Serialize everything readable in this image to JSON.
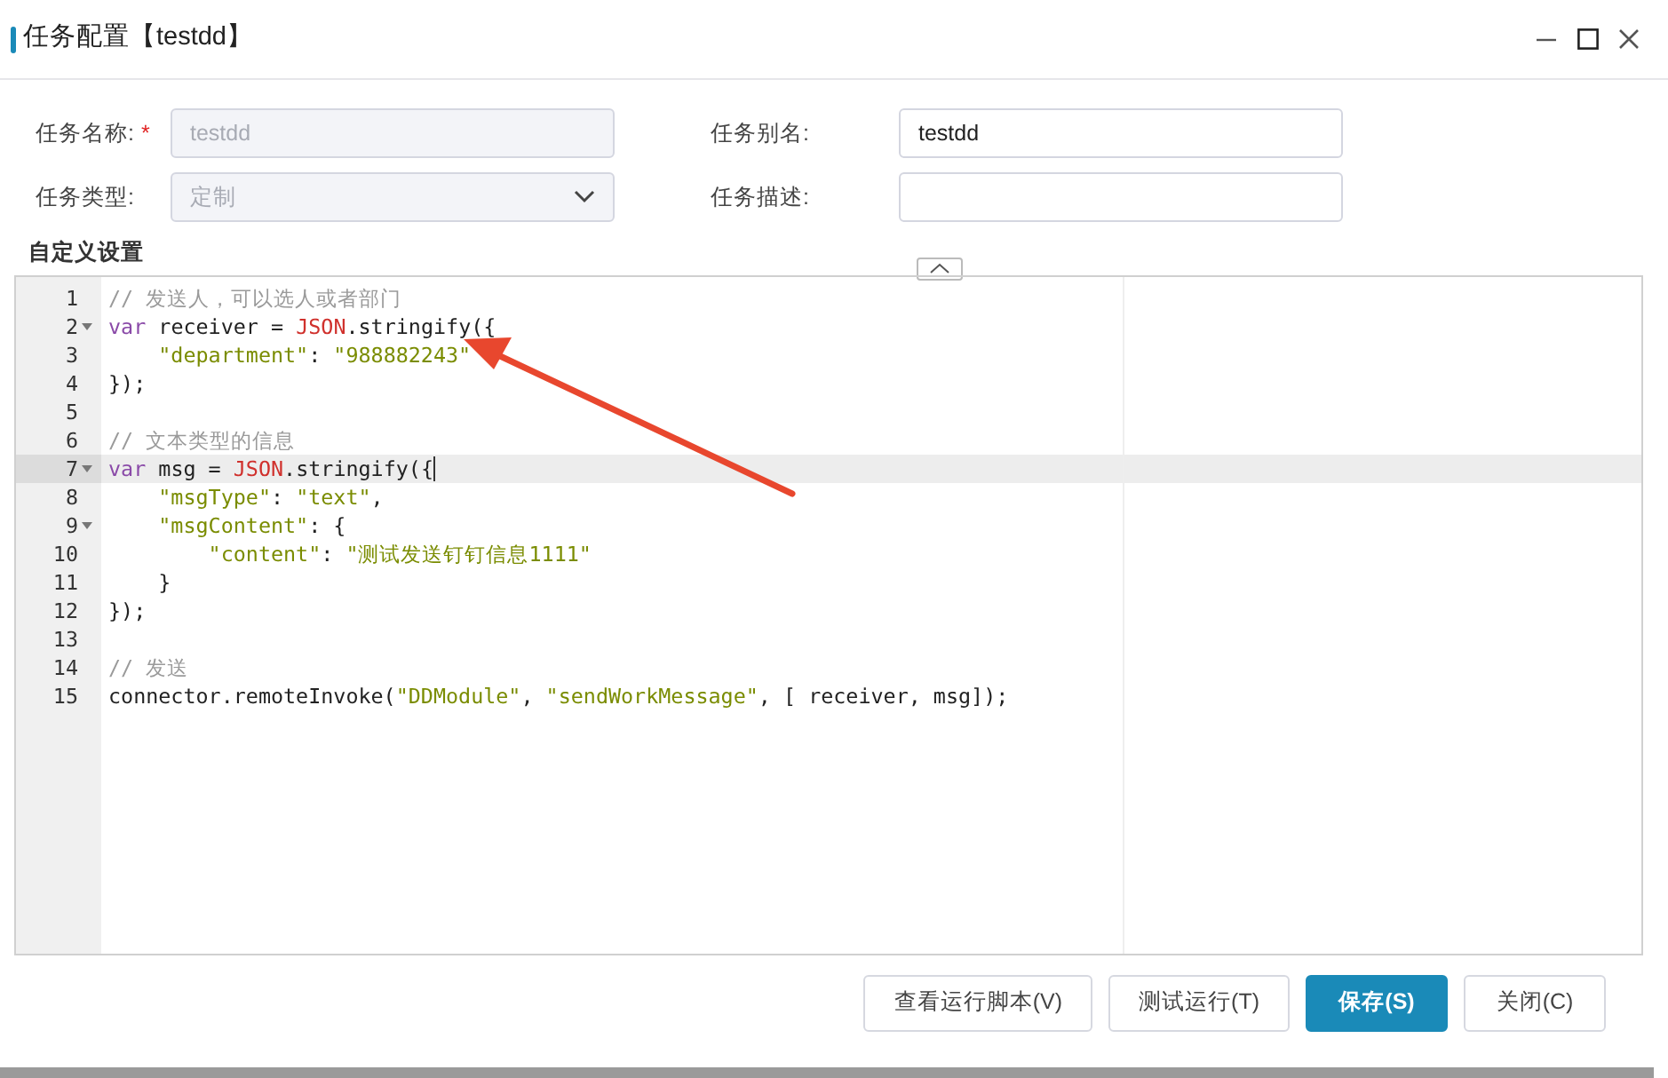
{
  "window": {
    "title": "任务配置【testdd】"
  },
  "form": [
    {
      "label": "任务名称:",
      "required_mark": "*",
      "kind": "input",
      "value": "testdd",
      "disabled": true
    },
    {
      "label": "任务别名:",
      "kind": "input",
      "value": "testdd",
      "disabled": false
    },
    {
      "label": "任务类型:",
      "kind": "select",
      "value": "定制",
      "disabled": true
    },
    {
      "label": "任务描述:",
      "kind": "input",
      "disabled": false
    }
  ],
  "section_title": "自定义设置",
  "editor": {
    "lines": [
      {
        "number": "1",
        "fold": false,
        "active": false,
        "tokens": [
          {
            "kind": "comment",
            "text": "// 发送人，可以选人或者部门"
          }
        ]
      },
      {
        "number": "2",
        "fold": true,
        "active": false,
        "tokens": [
          {
            "kind": "keyword",
            "text": "var"
          },
          {
            "kind": "plain",
            "text": " receiver = "
          },
          {
            "kind": "builtin",
            "text": "JSON"
          },
          {
            "kind": "plain",
            "text": ".stringify({"
          }
        ]
      },
      {
        "number": "3",
        "fold": false,
        "active": false,
        "tokens": [
          {
            "kind": "string",
            "text": "    \"department\""
          },
          {
            "kind": "plain",
            "text": ": "
          },
          {
            "kind": "string",
            "text": "\"988882243\""
          }
        ]
      },
      {
        "number": "4",
        "fold": false,
        "active": false,
        "tokens": [
          {
            "kind": "plain",
            "text": "});"
          }
        ]
      },
      {
        "number": "5",
        "fold": false,
        "active": false
      },
      {
        "number": "6",
        "fold": false,
        "active": false,
        "tokens": [
          {
            "kind": "comment",
            "text": "// 文本类型的信息"
          }
        ]
      },
      {
        "number": "7",
        "fold": true,
        "active": true,
        "tokens": [
          {
            "kind": "keyword",
            "text": "var"
          },
          {
            "kind": "plain",
            "text": " msg = "
          },
          {
            "kind": "builtin",
            "text": "JSON"
          },
          {
            "kind": "plain",
            "text": ".stringify({"
          }
        ]
      },
      {
        "number": "8",
        "fold": false,
        "active": false,
        "tokens": [
          {
            "kind": "string",
            "text": "    \"msgType\""
          },
          {
            "kind": "plain",
            "text": ": "
          },
          {
            "kind": "string",
            "text": "\"text\""
          },
          {
            "kind": "plain",
            "text": ","
          }
        ]
      },
      {
        "number": "9",
        "fold": true,
        "active": false,
        "tokens": [
          {
            "kind": "string",
            "text": "    \"msgContent\""
          },
          {
            "kind": "plain",
            "text": ": {"
          }
        ]
      },
      {
        "number": "10",
        "fold": false,
        "active": false,
        "tokens": [
          {
            "kind": "string",
            "text": "        \"content\""
          },
          {
            "kind": "plain",
            "text": ": "
          },
          {
            "kind": "string",
            "text": "\"测试发送钉钉信息1111\""
          }
        ]
      },
      {
        "number": "11",
        "fold": false,
        "active": false,
        "tokens": [
          {
            "kind": "plain",
            "text": "    }"
          }
        ]
      },
      {
        "number": "12",
        "fold": false,
        "active": false,
        "tokens": [
          {
            "kind": "plain",
            "text": "});"
          }
        ]
      },
      {
        "number": "13",
        "fold": false,
        "active": false
      },
      {
        "number": "14",
        "fold": false,
        "active": false,
        "tokens": [
          {
            "kind": "comment",
            "text": "// 发送"
          }
        ]
      },
      {
        "number": "15",
        "fold": false,
        "active": false,
        "tokens": [
          {
            "kind": "plain",
            "text": "connector.remoteInvoke("
          },
          {
            "kind": "string",
            "text": "\"DDModule\""
          },
          {
            "kind": "plain",
            "text": ", "
          },
          {
            "kind": "string",
            "text": "\"sendWorkMessage\""
          },
          {
            "kind": "plain",
            "text": ", [ receiver, msg]);"
          }
        ]
      }
    ]
  },
  "buttons": [
    {
      "label": "查看运行脚本(V)",
      "primary": false
    },
    {
      "label": "测试运行(T)",
      "primary": false
    },
    {
      "label": "保存(S)",
      "primary": true
    },
    {
      "label": "关闭(C)",
      "primary": false
    }
  ]
}
